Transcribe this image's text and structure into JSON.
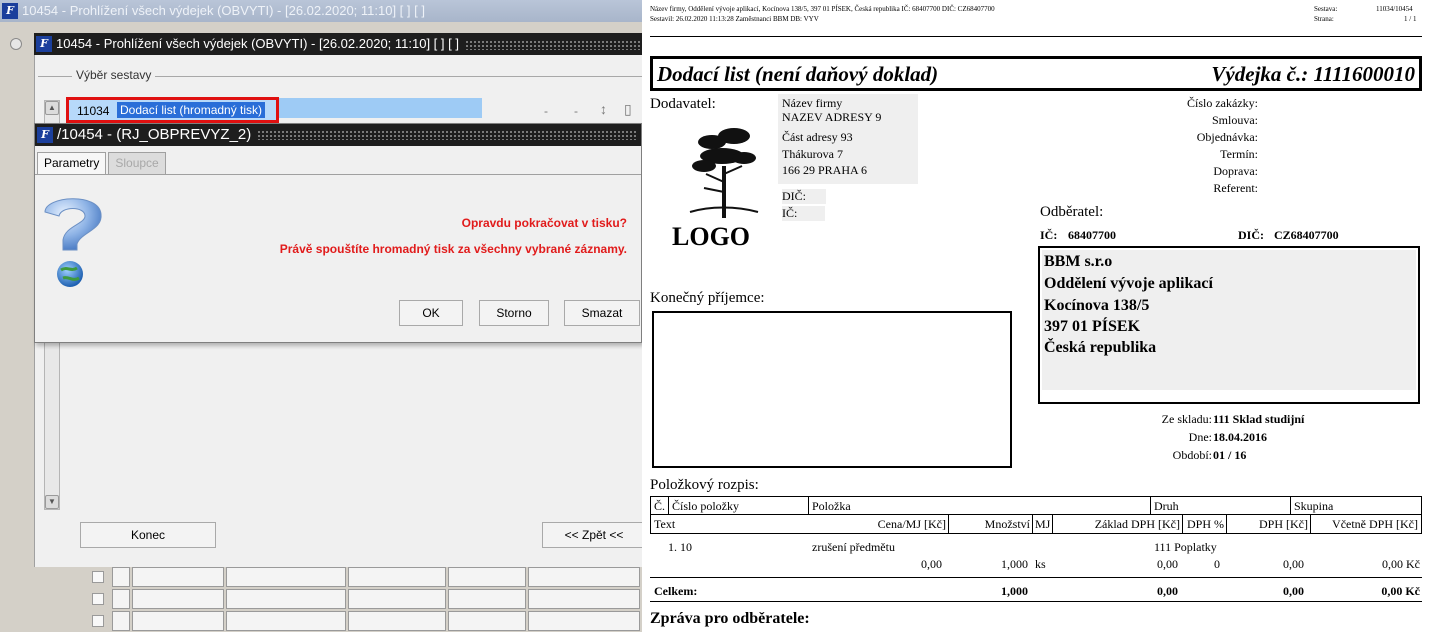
{
  "app": {
    "outer_title": "10454 - Prohlížení všech výdejek (OBVYTI) - [26.02.2020; 11:10]  [ ]  [ ]",
    "inner_title": "10454 - Prohlížení všech výdejek (OBVYTI) - [26.02.2020; 11:10]  [ ]  [ ]",
    "icon_glyph": "F",
    "fieldset_label": "Výběr sestavy",
    "selected_row": {
      "number": "11034",
      "text": "Dodací list (hromadný tisk)"
    },
    "row_tools": [
      "-",
      "-",
      "↕",
      "▯"
    ],
    "dialog": {
      "title": "/10454 - (RJ_OBPREVYZ_2)",
      "tabs": [
        "Parametry",
        "Sloupce"
      ],
      "message_1": "Opravdu pokračovat v tisku?",
      "message_2": "Právě spouštíte hromadný tisk za všechny vybrané záznamy.",
      "buttons": {
        "ok": "OK",
        "storno": "Storno",
        "smazat": "Smazat"
      }
    },
    "bottom": {
      "konec": "Konec",
      "zpet": "<< Zpět <<"
    }
  },
  "report": {
    "header_line_1": "Název firmy, Oddělení vývoje aplikací, Kocínova 138/5, 397 01 PÍSEK, Česká republika  IČ: 68407700  DIČ: CZ68407700",
    "header_line_2": "Sestavil: 26.02.2020 11:13:28 Zaměstnanci BBM  DB: VYV",
    "sestava_label": "Sestava:",
    "sestava_value": "11034/10454",
    "strana_label": "Strana:",
    "strana_value": "1 / 1",
    "doc_title": "Dodací list (není daňový doklad)",
    "doc_number": "Výdejka č.: 1111600010",
    "dodavatel_label": "Dodavatel:",
    "supplier_lines": [
      "Název firmy",
      "NAZEV ADRESY 9",
      "Část adresy 93",
      "Thákurova 7",
      "166 29 PRAHA 6"
    ],
    "supplier_dic": "DIČ:",
    "supplier_ic": "IČ:",
    "logo_text": "LOGO",
    "order_labels": [
      "Číslo zakázky:",
      "Smlouva:",
      "Objednávka:",
      "Termín:",
      "Doprava:",
      "Referent:"
    ],
    "odberatel_label": "Odběratel:",
    "ic_label": "IČ:",
    "ic_value": "68407700",
    "dic_label": "DIČ:",
    "dic_value": "CZ68407700",
    "customer_lines": [
      "BBM s.r.o",
      "Oddělení vývoje aplikací",
      "Kocínova 138/5",
      "397 01 PÍSEK",
      "Česká republika"
    ],
    "konecny_label": "Konečný příjemce:",
    "ze_skladu_label": "Ze skladu:",
    "ze_skladu_value": "111 Sklad studijní",
    "dne_label": "Dne:",
    "dne_value": "18.04.2016",
    "obdobi_label": "Období:",
    "obdobi_value": "01 / 16",
    "polozkovy_label": "Položkový rozpis:",
    "table_head_1": [
      "Č.",
      "Číslo položky",
      "Položka",
      "Druh",
      "Skupina"
    ],
    "table_head_2": [
      "Text",
      "Cena/MJ [Kč]",
      "Množství",
      "MJ",
      "Základ DPH [Kč]",
      "DPH %",
      "DPH [Kč]",
      "Včetně DPH [Kč]"
    ],
    "row1": {
      "no": "1. 10",
      "name": "zrušení předmětu",
      "druh": "111 Poplatky"
    },
    "row2": {
      "cena": "0,00",
      "mnozstvi": "1,000",
      "mj": "ks",
      "zaklad": "0,00",
      "dph_pct": "0",
      "dph": "0,00",
      "celkem": "0,00 Kč"
    },
    "celkem_label": "Celkem:",
    "total": {
      "mnozstvi": "1,000",
      "zaklad": "0,00",
      "dph": "0,00",
      "celkem": "0,00 Kč"
    },
    "zprava_label": "Zpráva pro odběratele:"
  }
}
